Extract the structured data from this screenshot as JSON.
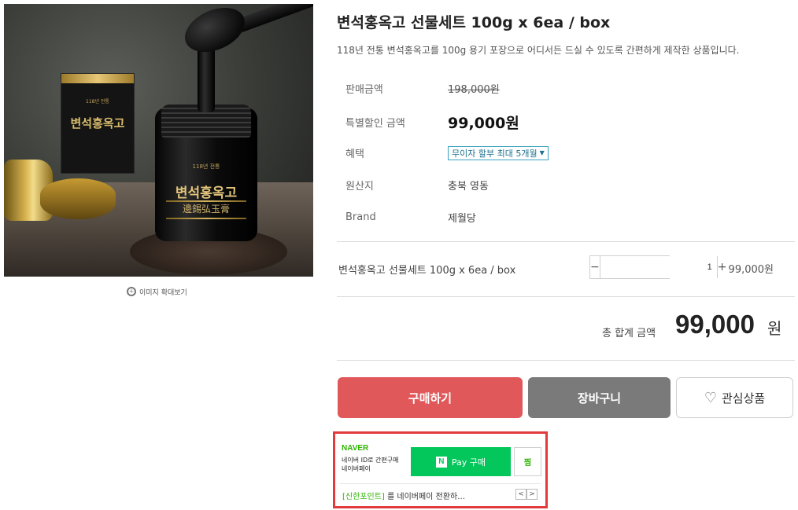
{
  "image": {
    "box_small_text": "118년 전통",
    "box_title": "변석홍옥고",
    "jar_top_text": "118년 전통",
    "jar_title": "변석홍옥고",
    "jar_hanja": "邊錫弘玉膏",
    "zoom_label": "이미지 확대보기"
  },
  "product": {
    "title": "변석홍옥고 선물세트 100g x 6ea / box",
    "description": "118년 전통 변석홍옥고를 100g 용기 포장으로 어디서든 드실 수 있도록 간편하게 제작한 상품입니다."
  },
  "info": [
    {
      "label": "판매금액",
      "value": "198,000원"
    },
    {
      "label": "특별할인 금액",
      "value": "99,000원"
    },
    {
      "label": "혜택",
      "value": "무이자 할부 최대 5개월",
      "arrow": "▼"
    },
    {
      "label": "원산지",
      "value": "충북 영동"
    },
    {
      "label": "Brand",
      "value": "제월당"
    }
  ],
  "option": {
    "name": "변석홍옥고 선물세트 100g x 6ea / box",
    "minus": "−",
    "plus": "+",
    "quantity": "1",
    "price": "99,000원"
  },
  "total": {
    "label": "총 합계 금액",
    "amount": "99,000",
    "unit": "원"
  },
  "buttons": {
    "buy": "구매하기",
    "cart": "장바구니",
    "wish": "관심상품",
    "wish_icon": "♡"
  },
  "naverpay": {
    "logo": "NAVER",
    "desc1": "네이버 ID로 간편구매",
    "desc2": "네이버페이",
    "n_mark": "N",
    "buy_label": "Pay 구매",
    "jjim_label": "찜",
    "promo_bracket": "[신한포인트]",
    "promo_text": " 를 네이버페이 전환하…",
    "prev": "<",
    "next": ">"
  },
  "colors": {
    "buy_button": "#e0585a",
    "cart_button": "#7a7a7a",
    "naver_green": "#03c75a",
    "npay_border": "#e23b3b"
  }
}
